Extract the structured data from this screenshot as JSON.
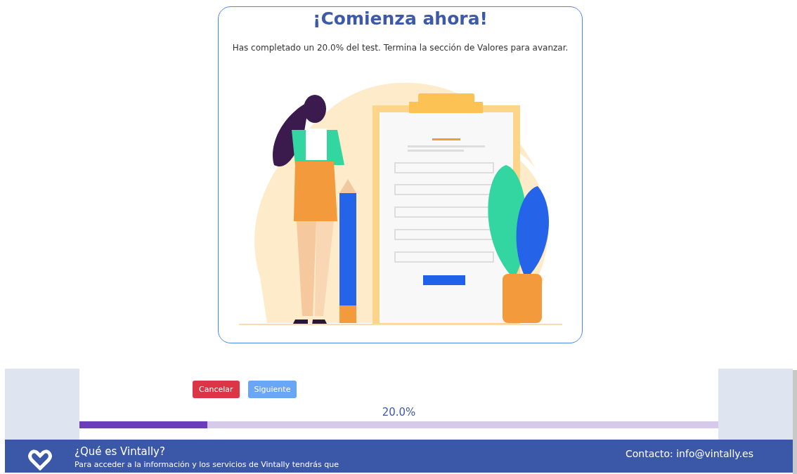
{
  "card": {
    "title": "¡Comienza ahora!",
    "message": "Has completado un 20.0% del test. Termina la sección de Valores para avanzar."
  },
  "buttons": [
    {
      "kind": "cancel",
      "label": "Cancelar"
    },
    {
      "kind": "next",
      "label": "Siguiente"
    }
  ],
  "progress": {
    "reading": "20.0%",
    "level": 0.2
  },
  "footer": {
    "heading": "¿Qué es Vintally?",
    "text": "Para acceder a la información y los servicios de Vintally tendrás que",
    "contact": "Contacto: info@vintally.es"
  }
}
